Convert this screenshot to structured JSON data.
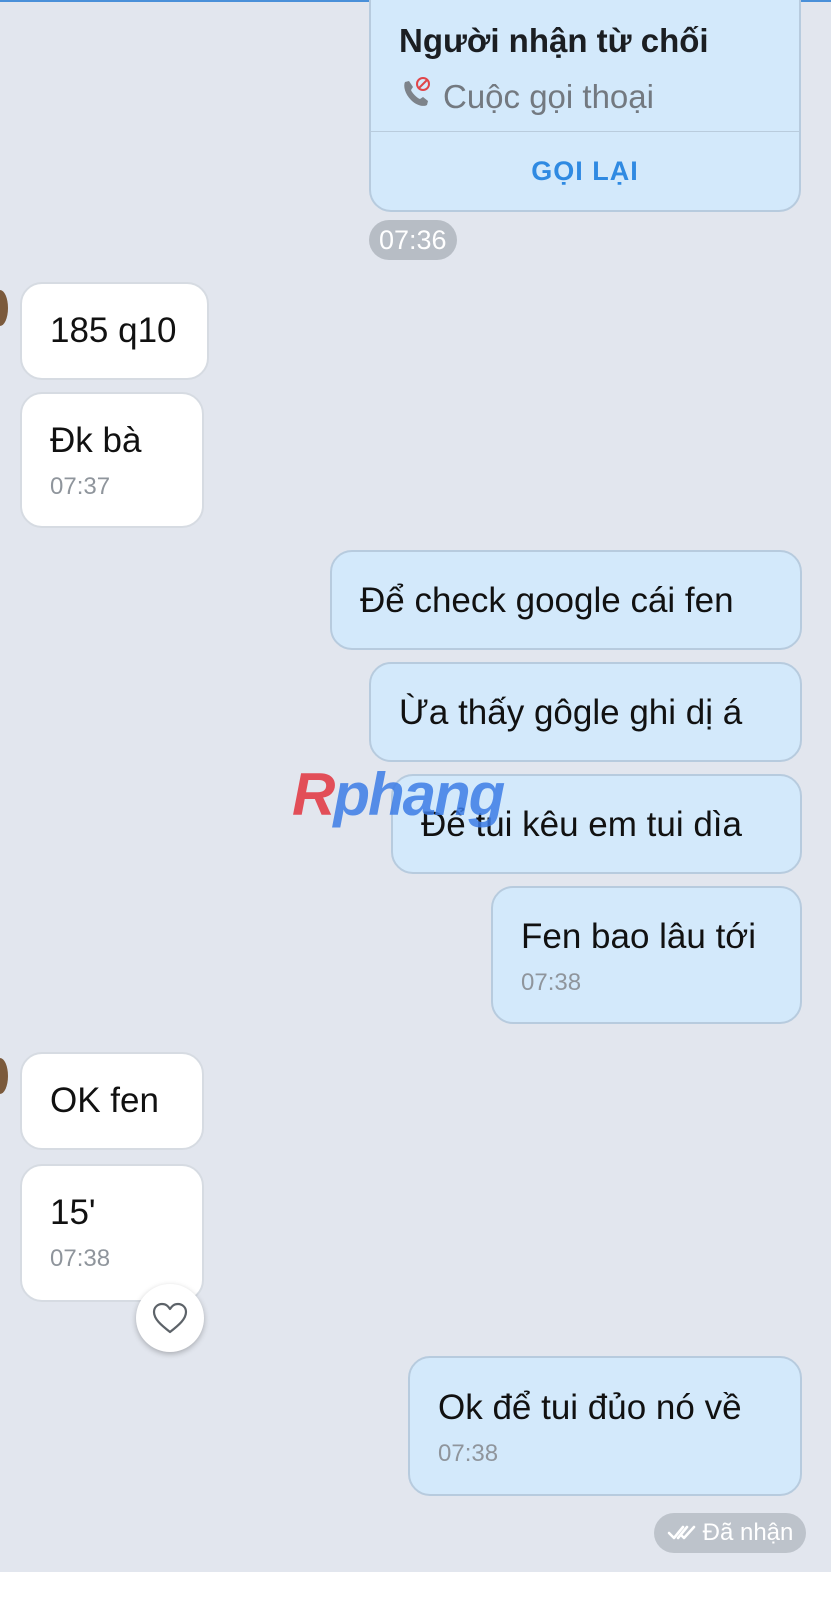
{
  "call_card": {
    "title": "Người nhận từ chối",
    "subtitle": "Cuộc gọi thoại",
    "action_label": "GỌI LẠI",
    "time": "07:36",
    "icon": "phone-declined-icon"
  },
  "messages": [
    {
      "direction": "in",
      "text": "185 q10",
      "time": ""
    },
    {
      "direction": "in",
      "text": "Đk bà",
      "time": "07:37"
    },
    {
      "direction": "out",
      "text": "Để check google cái fen",
      "time": ""
    },
    {
      "direction": "out",
      "text": "Ừa thấy gôgle ghi dị á",
      "time": ""
    },
    {
      "direction": "out",
      "text": "Để tui kêu em tui dìa",
      "time": ""
    },
    {
      "direction": "out",
      "text": "Fen bao lâu tới",
      "time": "07:38"
    },
    {
      "direction": "in",
      "text": "OK fen",
      "time": ""
    },
    {
      "direction": "in",
      "text": "15'",
      "time": "07:38"
    },
    {
      "direction": "out",
      "text": "Ok để tui đủo nó về",
      "time": "07:38"
    }
  ],
  "watermark": {
    "part1": "R",
    "part2": "phang"
  },
  "status": {
    "label": "Đã nhận",
    "icon": "double-check-icon"
  },
  "reaction": {
    "icon": "heart-icon"
  },
  "colors": {
    "background": "#e2e6ee",
    "incoming_bubble": "#ffffff",
    "outgoing_bubble": "#d3e9fb",
    "accent": "#2f8ae2"
  }
}
